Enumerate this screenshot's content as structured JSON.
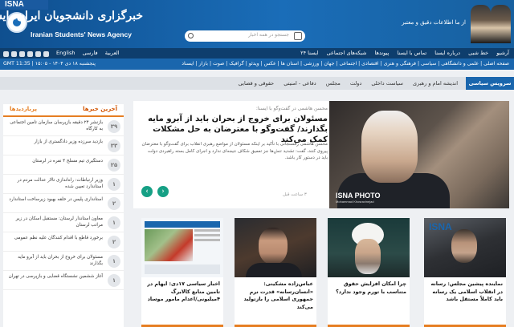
{
  "header": {
    "tab": "ISNA",
    "brand_fa": "خبرگزاری دانشجویان ایران، ایسنا",
    "brand_en": "Iranian Students' News Agency",
    "slogan": "از ما اطلاعات دقیق و معتبر",
    "search_placeholder": "جستجو در همه اخبار"
  },
  "nav_top": {
    "items": [
      "آرشیو",
      "خط شبی",
      "درباره ایسنا",
      "تماس با ایسنا",
      "پیوندها",
      "شبکه‌های اجتماعی",
      "ایسنا ۲۴"
    ],
    "languages": [
      "English",
      "العربیة",
      "فارسی"
    ]
  },
  "nav_cats": {
    "categories": "صفحه اصلی | علمی و دانشگاهی | سیاسی | فرهنگی و هنری | اقتصادی | اجتماعی | جهان | ورزشی | استان ها | عکس | ویدئو | گرافیک | صوت | بازار | ایسناد",
    "date": "پنجشنبه ۱۸ دی ۱۴۰۴ - ۱۵:۰۵ | GMT 11:35"
  },
  "nav_sub": {
    "service": "سرویس سیاسی",
    "items": [
      "اندیشه امام و رهبری",
      "سیاست داخلی",
      "دولت",
      "مجلس",
      "دفاعی - امنیتی",
      "حقوقی و قضایی"
    ]
  },
  "sidebar": {
    "tab_latest": "آخرین خبرها",
    "tab_popular": "پربازدیدها",
    "items": [
      {
        "n": "۳۹",
        "t": "بازنشر ۲۴ دقیقه بازپرسان سازمان تامین اجتماعی به کارگاه"
      },
      {
        "n": "۳۳",
        "t": "بازدید سرزده وزیر دادگستری از بازار"
      },
      {
        "n": "۲۵",
        "t": "دستگیری تیم مسلح ۴ نفره در لرستان"
      },
      {
        "n": "۱",
        "t": "وزیر ارتباطات: راه‌اندازی تالار عدالت مردم در استاندارد تعیین شده"
      },
      {
        "n": "۲",
        "t": "استانداری پلیس در حلقه بهبود زیرساخت استاندارد"
      },
      {
        "n": "۱",
        "t": "معاون استاندار لرستان: مستقبل اسکان در زیر مراتب لرستان"
      },
      {
        "n": "۲",
        "t": "برخورد قاطع با اقدام کنندگان علیه نظم عمومی"
      },
      {
        "n": "۱",
        "t": "مسئولان برای خروج از بحران باید از آبرو مایه بگذارند"
      },
      {
        "n": "۱",
        "t": "آغاز ششمین نشستگاه قضایی و بازپرسی در تهران"
      }
    ]
  },
  "featured": {
    "kicker": "محسن هاشمی در گفت‌وگو با ایسنا:",
    "title": "مسئولان برای خروج از بحران باید از آبرو مایه بگذارند/ گفت‌وگو با معترضان به حل مشکلات کمک می‌کند",
    "lead": "محسن هاشمی رفسنجانی با تأکید بر اینکه مسئولان از مواضع رهبری انقلاب برای گفت‌وگو با معترضان پیروی کنند، گفت: تشدید تنش‌ها جز تعمیق شکاف نتیجه‌ای ندارد و اجرای کامل بسته راهبردی دولت باید در دستور کار باشد.",
    "time": "۳ ساعت قبل",
    "watermark": "ISNA PHOTO",
    "watermark_sub": "Mohammad Khosravinejad"
  },
  "cards": [
    {
      "title": "نماینده پیشین مجلس: رسانه در انقلاب اسلامی یک رسانه باید کاملاً مستقل باشد",
      "watermark": "ISNA"
    },
    {
      "title": "چرا امکان افزایش حقوق متناسب با تورم وجود ندارد؟",
      "watermark": ""
    },
    {
      "title": "عباس‌زاده مشکینی: «انسان‌رسانه» قدرت نرم جمهوری اسلامی را بازتولید می‌کند",
      "watermark": ""
    },
    {
      "title": "اخبار سیاسی ۱۷دی: ایهام در تامین منابع کالابرگ ۴میلیونی/اعدام مامور موساد",
      "watermark": ""
    }
  ]
}
